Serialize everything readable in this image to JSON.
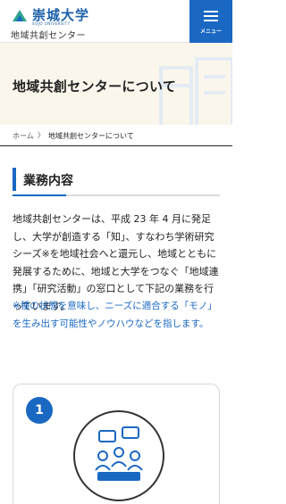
{
  "header": {
    "logo_name": "崇城大学",
    "logo_sub": "SOJO UNIVERSITY",
    "center_name": "地域共創センター",
    "menu_label": "メニュー"
  },
  "hero": {
    "title": "地域共創センターについて"
  },
  "breadcrumb": {
    "home": "ホーム",
    "separator": "〉",
    "current": "地域共創センターについて"
  },
  "section": {
    "heading": "業務内容",
    "body": "地域共創センターは、平成 23 年 4 月に発足し、大学が創造する「知」、すなわち学術研究シーズ※を地域社会へと還元し、地域とともに発展するために、地域と大学をつなぐ「地域連携」「研究活動」の窓口として下記の業務を行っています。",
    "note": "※種の状態を意味し、ニーズに適合する「モノ」を生み出す可能性やノウハウなどを指します。"
  },
  "card": {
    "number": "1"
  },
  "colors": {
    "brand": "#1a68c2",
    "hero_bg": "#fbf6ec",
    "note": "#1a68c2"
  },
  "icons": {
    "menu": "hamburger-icon",
    "logo": "university-logo-mark",
    "card": "meeting-people-icon"
  }
}
